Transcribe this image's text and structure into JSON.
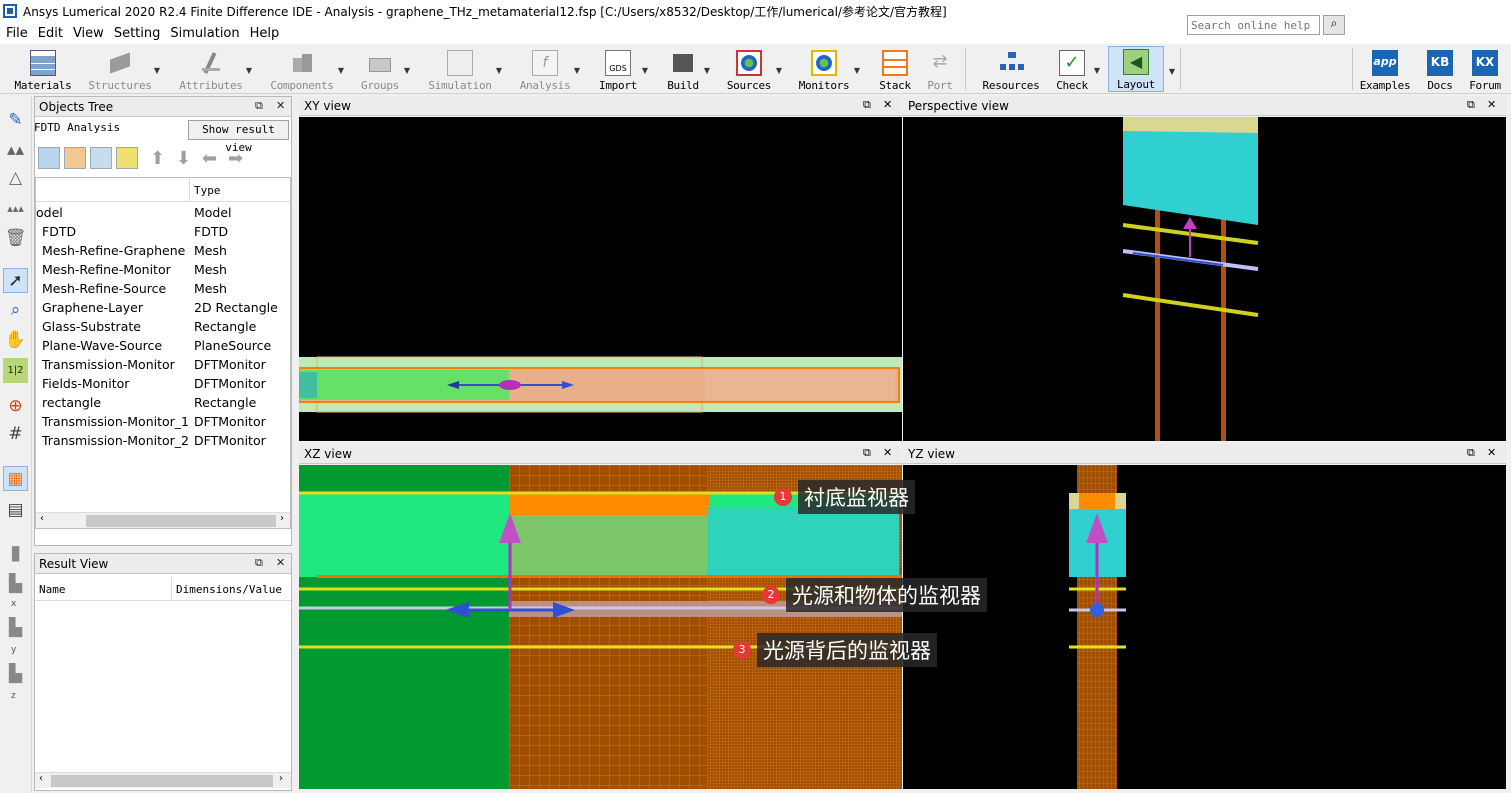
{
  "window": {
    "title": "Ansys Lumerical 2020 R2.4 Finite Difference IDE - Analysis - graphene_THz_metamaterial12.fsp [C:/Users/x8532/Desktop/工作/lumerical/参考论文/官方教程]"
  },
  "menu": [
    "File",
    "Edit",
    "View",
    "Setting",
    "Simulation",
    "Help"
  ],
  "toolbar": {
    "materials": "Materials",
    "structures": "Structures",
    "attributes": "Attributes",
    "components": "Components",
    "groups": "Groups",
    "simulation": "Simulation",
    "analysis": "Analysis",
    "import": "Import",
    "build": "Build",
    "sources": "Sources",
    "monitors": "Monitors",
    "stack": "Stack",
    "port": "Port",
    "resources": "Resources",
    "check": "Check",
    "layout": "Layout",
    "search_placeholder": "Search online help",
    "examples": "Examples",
    "docs": "Docs",
    "forum": "Forum",
    "gds_text": "GDS",
    "app_text": "app",
    "kb_text": "KB",
    "kx_text": "KX"
  },
  "objects_tree": {
    "title": "Objects Tree",
    "analysis_label": "FDTD Analysis",
    "show_result_view": "Show result view",
    "col_type": "Type",
    "rows": [
      {
        "name": "odel",
        "type": "Model"
      },
      {
        "name": "FDTD",
        "type": "FDTD"
      },
      {
        "name": "Mesh-Refine-Graphene",
        "type": "Mesh"
      },
      {
        "name": "Mesh-Refine-Monitor",
        "type": "Mesh"
      },
      {
        "name": "Mesh-Refine-Source",
        "type": "Mesh"
      },
      {
        "name": "Graphene-Layer",
        "type": "2D Rectangle"
      },
      {
        "name": "Glass-Substrate",
        "type": "Rectangle"
      },
      {
        "name": "Plane-Wave-Source",
        "type": "PlaneSource"
      },
      {
        "name": "Transmission-Monitor",
        "type": "DFTMonitor"
      },
      {
        "name": "Fields-Monitor",
        "type": "DFTMonitor"
      },
      {
        "name": "rectangle",
        "type": "Rectangle"
      },
      {
        "name": "Transmission-Monitor_1",
        "type": "DFTMonitor"
      },
      {
        "name": "Transmission-Monitor_2",
        "type": "DFTMonitor"
      }
    ]
  },
  "result_view": {
    "title": "Result View",
    "col_name": "Name",
    "col_dim": "Dimensions/Value"
  },
  "views": {
    "xy": "XY view",
    "perspective": "Perspective view",
    "xz": "XZ view",
    "yz": "YZ view"
  },
  "axes_labels": {
    "x": "x",
    "y": "y",
    "z": "z"
  },
  "annotations": [
    {
      "num": "1",
      "text": "衬底监视器"
    },
    {
      "num": "2",
      "text": "光源和物体的监视器"
    },
    {
      "num": "3",
      "text": "光源背后的监视器"
    }
  ]
}
